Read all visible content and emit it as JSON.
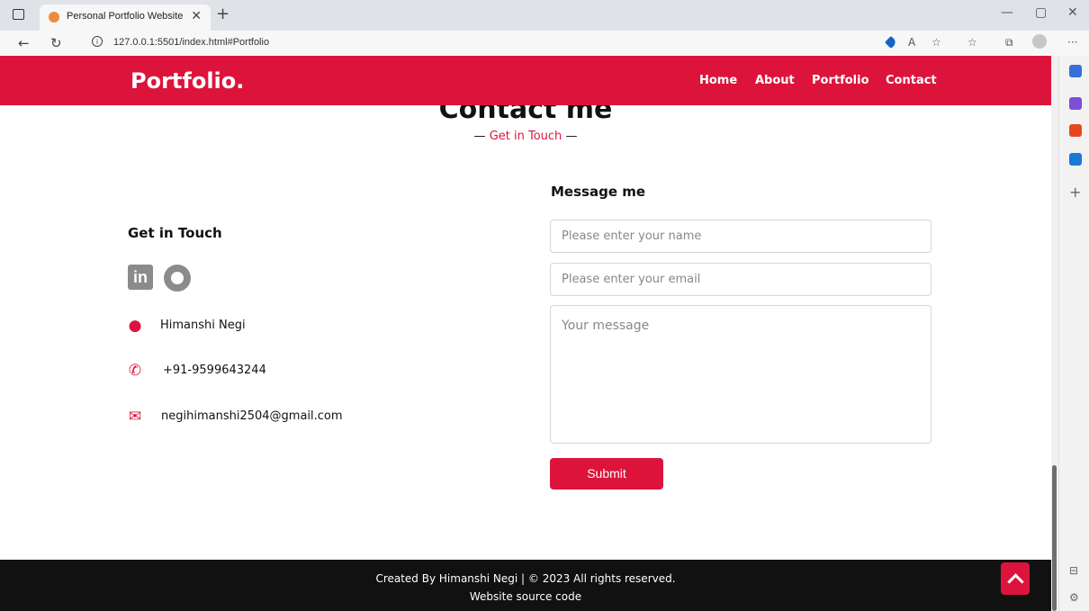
{
  "browser": {
    "tab_title": "Personal Portfolio Website",
    "url": "127.0.0.1:5501/index.html#Portfolio",
    "icons": [
      "tab-toggle-icon",
      "close-icon",
      "plus-icon",
      "minimize-icon",
      "restore-icon",
      "close-window-icon",
      "back-icon",
      "refresh-icon",
      "info-icon",
      "extension-icon",
      "read-aloud-icon",
      "favorite-icon",
      "favorites-icon",
      "collections-icon",
      "profile-icon",
      "more-icon"
    ]
  },
  "site": {
    "brand": "Portfolio.",
    "menu": [
      "Home",
      "About",
      "Portfolio",
      "Contact"
    ]
  },
  "section": {
    "title": "Contact me",
    "subtitle": "Get in Touch"
  },
  "left": {
    "heading": "Get in Touch",
    "name": "Himanshi Negi",
    "phone": "+91-9599643244",
    "email": "negihimanshi2504@gmail.com"
  },
  "form": {
    "heading": "Message me",
    "name_placeholder": "Please enter your name",
    "email_placeholder": "Please enter your email",
    "message_placeholder": "Your message",
    "submit_label": "Submit"
  },
  "footer": {
    "line1": "Created By Himanshi Negi | © 2023 All rights reserved.",
    "line2": "Website source code"
  },
  "colors": {
    "accent": "#dc143c",
    "footer_bg": "#111111"
  }
}
